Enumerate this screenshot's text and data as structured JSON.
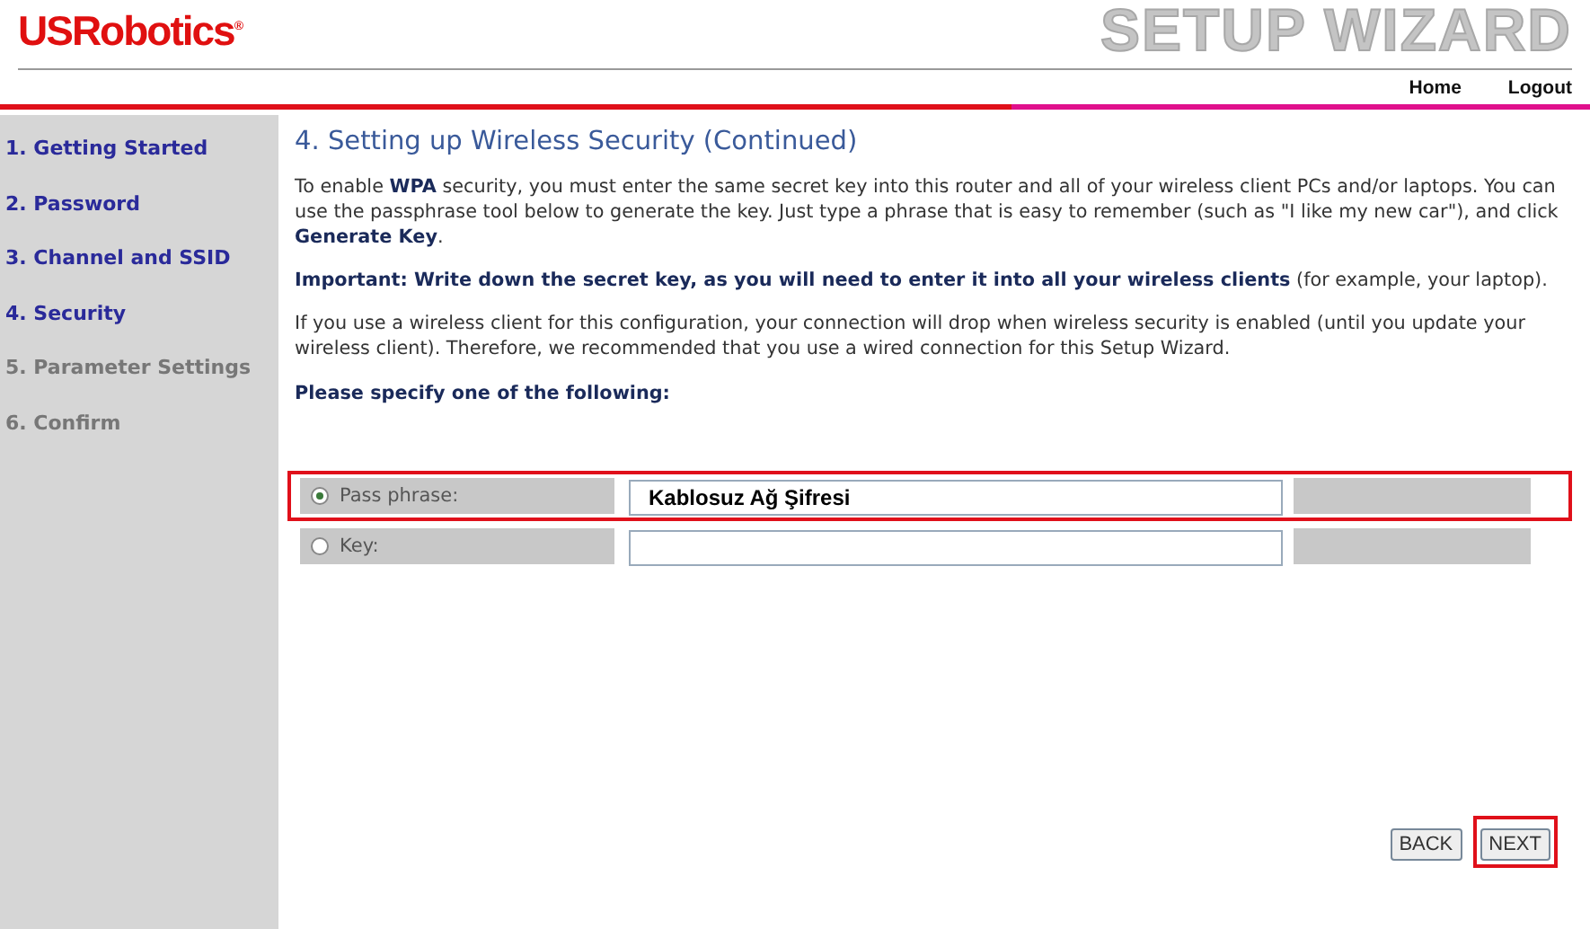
{
  "header": {
    "logo": "USRobotics",
    "logo_mark": "®",
    "title": "SETUP WIZARD",
    "nav": [
      "Home",
      "Logout"
    ]
  },
  "sidebar": {
    "items": [
      {
        "label": "1. Getting Started",
        "done": true
      },
      {
        "label": "2. Password",
        "done": true
      },
      {
        "label": "3. Channel and SSID",
        "done": true
      },
      {
        "label": "4. Security",
        "done": true
      },
      {
        "label": "5. Parameter Settings",
        "done": false
      },
      {
        "label": "6. Confirm",
        "done": false
      }
    ]
  },
  "content": {
    "heading": "4. Setting up Wireless Security (Continued)",
    "paragraphs": [
      "To enable **WPA** security, you must enter the same secret key into this router and all of your wireless client PCs and/or laptops. You can use the passphrase tool below to generate the key. Just type a phrase that is easy to remember (such as \"I like my new car\"), and click **Generate Key**.",
      "**Important: Write down the secret key, as you will need to enter it into all your wireless clients** (for example, your laptop).",
      "If you use a wireless client for this configuration, your connection will drop when wireless security is enabled (until you update your wireless client). Therefore, we recommended that you use a wired connection for this Setup Wizard."
    ],
    "prompt": "Please specify one of the following:",
    "options": [
      {
        "label": "Pass phrase:",
        "selected": true,
        "value": "Kablosuz Ağ Şifresi",
        "highlighted": true
      },
      {
        "label": "Key:",
        "selected": false,
        "highlighted": false
      }
    ],
    "buttons": [
      {
        "label": "BACK",
        "highlighted": false
      },
      {
        "label": "NEXT",
        "highlighted": true
      }
    ]
  }
}
